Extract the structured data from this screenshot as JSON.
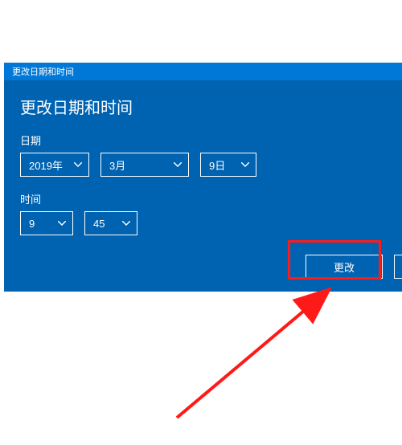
{
  "titleBar": "更改日期和时间",
  "heading": "更改日期和时间",
  "dateLabel": "日期",
  "timeLabel": "时间",
  "year": "2019年",
  "month": "3月",
  "day": "9日",
  "hour": "9",
  "minute": "45",
  "changeButton": "更改",
  "cancelButton": ""
}
